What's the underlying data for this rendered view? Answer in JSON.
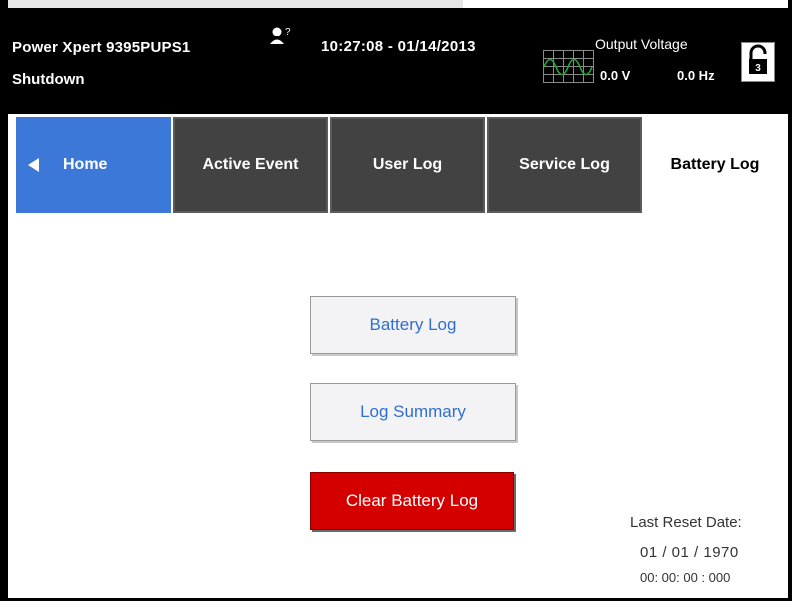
{
  "header": {
    "device_name": "Power Xpert 9395PUPS1",
    "status": "Shutdown",
    "datetime": "10:27:08 - 01/14/2013",
    "user_icon_badge": "?",
    "output_label": "Output Voltage",
    "output_voltage": "0.0 V",
    "output_frequency": "0.0 Hz",
    "lock_level": "3"
  },
  "tabs": [
    {
      "label": "Home"
    },
    {
      "label": "Active Event"
    },
    {
      "label": "User Log"
    },
    {
      "label": "Service Log"
    },
    {
      "label": "Battery Log"
    }
  ],
  "actions": {
    "battery_log": "Battery Log",
    "log_summary": "Log Summary",
    "clear_battery_log": "Clear Battery Log"
  },
  "reset": {
    "label": "Last Reset Date:",
    "date": "01 / 01 / 1970",
    "time": "00: 00: 00 : 000"
  },
  "colors": {
    "home_tab": "#3c78d8",
    "dark_tab": "#424242",
    "clear_button": "#d40000",
    "link_text": "#2f6fd0",
    "waveform": "#22aa33"
  },
  "icons": {
    "user": "user-question-icon",
    "scope": "waveform-scope-icon",
    "lock": "unlocked-padlock-icon",
    "home_arrow": "left-arrow-icon"
  }
}
